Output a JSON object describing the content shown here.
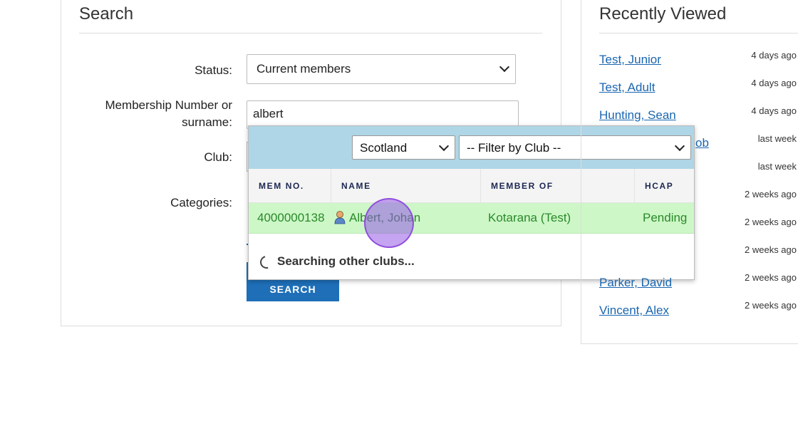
{
  "search": {
    "title": "Search",
    "status_label": "Status:",
    "status_value": "Current members",
    "surname_label_line1": "Membership Number or",
    "surname_label_line2": "surname:",
    "surname_value": "albert",
    "club_label": "Club:",
    "categories_label": "Categories:",
    "search_button": "SEARCH"
  },
  "autocomplete": {
    "region_value": "Scotland",
    "club_filter_value": "-- Filter by Club --",
    "columns": [
      "MEM NO.",
      "NAME",
      "MEMBER OF",
      "HCAP"
    ],
    "rows": [
      {
        "mem_no": "4000000138",
        "name": "Albert, Johan",
        "member_of": "Kotarana (Test)",
        "hcap": "Pending",
        "icon": "member-icon"
      }
    ],
    "status_text": "Searching other clubs...",
    "highlight_color": "#cdf7c7"
  },
  "recently_viewed": {
    "title": "Recently Viewed",
    "items": [
      {
        "name": "Test, Junior",
        "time": "4 days ago"
      },
      {
        "name": "Test, Adult",
        "time": "4 days ago"
      },
      {
        "name": "Hunting, Sean",
        "time": "4 days ago"
      },
      {
        "name": "ob",
        "time": "last week"
      },
      {
        "name": "",
        "time": "last week"
      },
      {
        "name": "",
        "time": "2 weeks ago"
      },
      {
        "name": "",
        "time": "2 weeks ago"
      },
      {
        "name": "",
        "time": "2 weeks ago"
      },
      {
        "name": "Parker, David",
        "time": "2 weeks ago"
      },
      {
        "name": "Vincent, Alex",
        "time": "2 weeks ago"
      }
    ]
  }
}
